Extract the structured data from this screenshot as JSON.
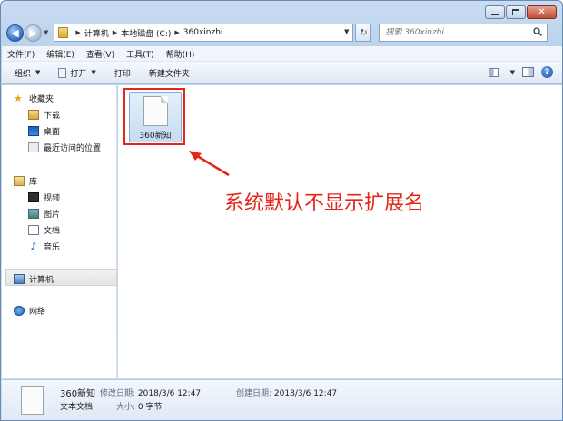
{
  "window": {
    "caption": {
      "minimize": "minimize",
      "maximize": "maximize",
      "close": "close"
    }
  },
  "address": {
    "crumbs": [
      "计算机",
      "本地磁盘 (C:)",
      "360xinzhi"
    ]
  },
  "search": {
    "placeholder": "搜索 360xinzhi"
  },
  "menu": [
    "文件(F)",
    "编辑(E)",
    "查看(V)",
    "工具(T)",
    "帮助(H)"
  ],
  "toolbar": {
    "organize": "组织",
    "open": "打开",
    "print": "打印",
    "new_folder": "新建文件夹"
  },
  "navpane": {
    "favorites": "收藏夹",
    "downloads": "下载",
    "desktop": "桌面",
    "recent": "最近访问的位置",
    "libraries": "库",
    "videos": "视频",
    "pictures": "图片",
    "documents": "文档",
    "music": "音乐",
    "computer": "计算机",
    "network": "网络"
  },
  "content": {
    "file_name": "360新知",
    "annotation": "系统默认不显示扩展名"
  },
  "details": {
    "name": "360新知",
    "modified_label": "修改日期:",
    "modified_value": "2018/3/6 12:47",
    "created_label": "创建日期:",
    "created_value": "2018/3/6 12:47",
    "type": "文本文档",
    "size_label": "大小:",
    "size_value": "0 字节"
  },
  "colors": {
    "annotation": "#e4261a",
    "accent": "#3e86e4"
  },
  "icons": [
    "back-icon",
    "forward-icon",
    "folder-icon",
    "refresh-icon",
    "search-icon",
    "views-icon",
    "preview-pane-icon",
    "help-icon",
    "text-file-icon"
  ]
}
